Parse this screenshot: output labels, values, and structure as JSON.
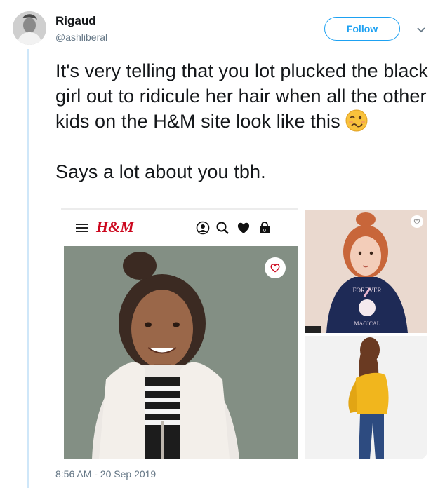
{
  "tweet": {
    "author_name": "Rigaud",
    "author_handle": "@ashliberal",
    "follow_label": "Follow",
    "text_line1": "It's very telling that you lot plucked the black girl out to ridicule her hair when all the other kids on the H&M site look like this",
    "emoji": "woozy-face",
    "text_line2": "Says a lot about you tbh.",
    "timestamp": "8:56 AM - 20 Sep 2019"
  },
  "media": {
    "site_logo": "H&M",
    "shirt_text_top": "FOREVER",
    "shirt_text_bottom": "MAGICAL",
    "icons": [
      "menu-icon",
      "account-icon",
      "search-icon",
      "heart-icon",
      "bag-icon",
      "favorite-icon"
    ]
  },
  "colors": {
    "brand_blue": "#1da1f2",
    "hm_red": "#cc071e",
    "thread_line": "#cfe7f9",
    "muted_text": "#657786"
  }
}
